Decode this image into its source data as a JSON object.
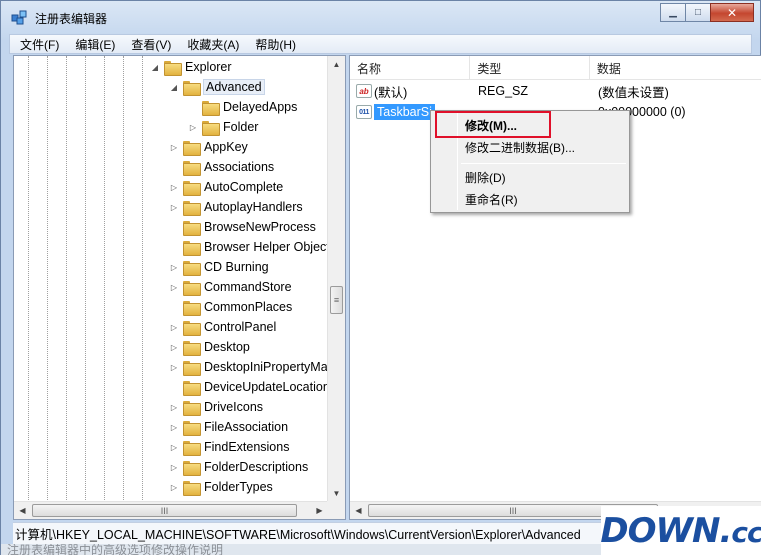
{
  "window": {
    "title": "注册表编辑器",
    "buttons": {
      "minimize": "▁",
      "maximize": "□",
      "close": "✕"
    }
  },
  "menu": [
    "文件(F)",
    "编辑(E)",
    "查看(V)",
    "收藏夹(A)",
    "帮助(H)"
  ],
  "tree": {
    "nodes": [
      {
        "label": "Explorer",
        "expander": "◢",
        "indent": 1
      },
      {
        "label": "Advanced",
        "expander": "◢",
        "indent": 2,
        "selected": true
      },
      {
        "label": "DelayedApps",
        "expander": "",
        "indent": 3
      },
      {
        "label": "Folder",
        "expander": "▷",
        "indent": 3
      },
      {
        "label": "AppKey",
        "expander": "▷",
        "indent": 2
      },
      {
        "label": "Associations",
        "expander": "",
        "indent": 2
      },
      {
        "label": "AutoComplete",
        "expander": "▷",
        "indent": 2
      },
      {
        "label": "AutoplayHandlers",
        "expander": "▷",
        "indent": 2
      },
      {
        "label": "BrowseNewProcess",
        "expander": "",
        "indent": 2
      },
      {
        "label": "Browser Helper Objects",
        "expander": "",
        "indent": 2
      },
      {
        "label": "CD Burning",
        "expander": "▷",
        "indent": 2
      },
      {
        "label": "CommandStore",
        "expander": "▷",
        "indent": 2
      },
      {
        "label": "CommonPlaces",
        "expander": "",
        "indent": 2
      },
      {
        "label": "ControlPanel",
        "expander": "▷",
        "indent": 2
      },
      {
        "label": "Desktop",
        "expander": "▷",
        "indent": 2
      },
      {
        "label": "DesktopIniPropertyMap",
        "expander": "▷",
        "indent": 2
      },
      {
        "label": "DeviceUpdateLocations",
        "expander": "",
        "indent": 2
      },
      {
        "label": "DriveIcons",
        "expander": "▷",
        "indent": 2
      },
      {
        "label": "FileAssociation",
        "expander": "▷",
        "indent": 2
      },
      {
        "label": "FindExtensions",
        "expander": "▷",
        "indent": 2
      },
      {
        "label": "FolderDescriptions",
        "expander": "▷",
        "indent": 2
      },
      {
        "label": "FolderTypes",
        "expander": "▷",
        "indent": 2
      }
    ]
  },
  "list": {
    "columns": [
      "名称",
      "类型",
      "数据"
    ],
    "rows": [
      {
        "name": "(默认)",
        "type": "REG_SZ",
        "data": "(数值未设置)",
        "icon": "ab"
      },
      {
        "name": "TaskbarSi",
        "type": "",
        "data": "0x00000000 (0)",
        "icon": "011",
        "selected": true
      }
    ]
  },
  "context_menu": {
    "items": [
      {
        "label": "修改(M)...",
        "bold": true
      },
      {
        "label": "修改二进制数据(B)..."
      },
      {
        "label": "删除(D)"
      },
      {
        "label": "重命名(R)"
      }
    ]
  },
  "scrollbar": {
    "thumb_glyph": "≡",
    "hthumb_glyph": "III",
    "up": "▲",
    "down": "▼",
    "left": "◀",
    "right": "▶"
  },
  "status": "计算机\\HKEY_LOCAL_MACHINE\\SOFTWARE\\Microsoft\\Windows\\CurrentVersion\\Explorer\\Advanced",
  "bottom_caption": "注册表编辑器中的高级选项修改操作说明",
  "watermark": {
    "text": "DOWN",
    "suffix": "cc",
    "dot": "."
  }
}
